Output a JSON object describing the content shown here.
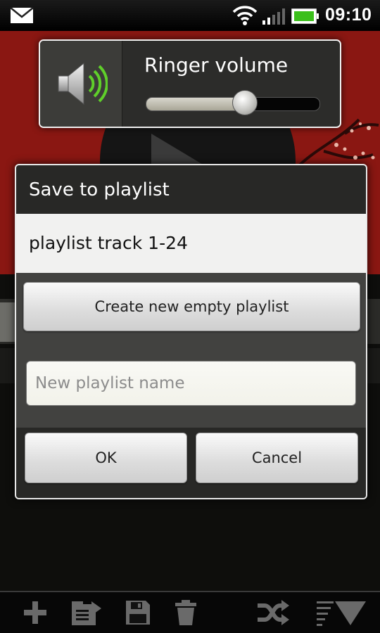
{
  "status_bar": {
    "time": "09:10",
    "icons": [
      "mail-icon",
      "wifi-icon",
      "signal-icon",
      "battery-icon"
    ]
  },
  "volume_panel": {
    "title": "Ringer volume",
    "icon": "speaker-icon",
    "level": 0.57
  },
  "dialog": {
    "title": "Save to playlist",
    "playlists": [
      "playlist track 1-24"
    ],
    "create_button": "Create new empty playlist",
    "name_input": {
      "value": "",
      "placeholder": "New playlist name"
    },
    "ok_button": "OK",
    "cancel_button": "Cancel"
  },
  "toolbar": {
    "icons": [
      "add-icon",
      "export-icon",
      "save-icon",
      "trash-icon",
      "shuffle-icon",
      "sort-down-icon"
    ]
  },
  "colors": {
    "background_red": "#8a1712",
    "dialog_dark": "#282826",
    "accent_green": "#5fcf2a"
  }
}
